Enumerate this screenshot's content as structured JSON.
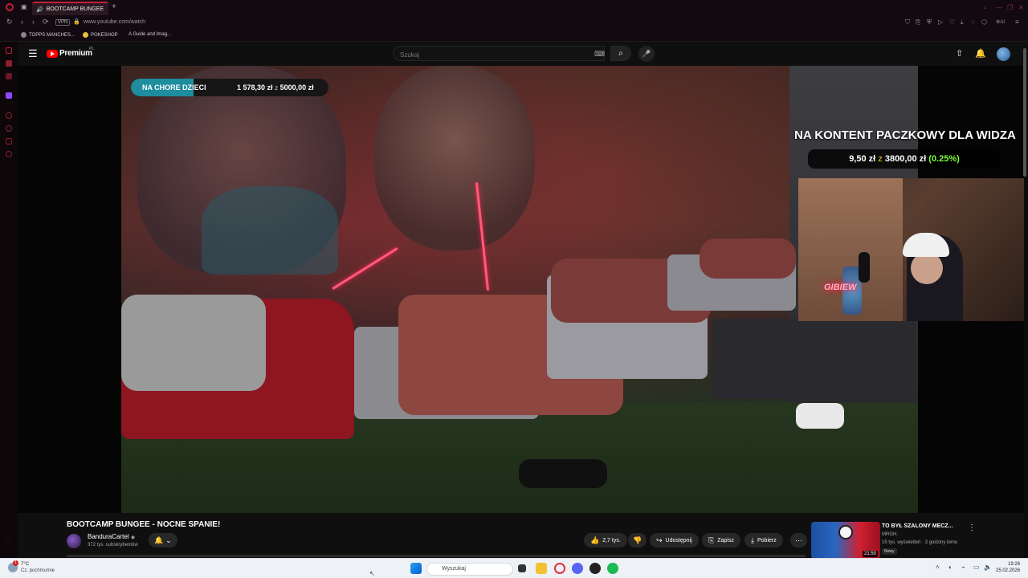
{
  "browser": {
    "tab_title": "BOOTCAMP BUNGEE",
    "vpn_label": "VPN",
    "url": "www.youtube.com/watch",
    "ai_label": "AI",
    "bookmarks": [
      {
        "label": "TOPPS MANCHES..."
      },
      {
        "label": "POKESHOP"
      },
      {
        "label": "A Guide and Imag..."
      }
    ]
  },
  "youtube": {
    "brand": "Premium",
    "brand_region": "PL",
    "search_placeholder": "Szukaj"
  },
  "overlay": {
    "donation_label": "NA CHORE DZIECI",
    "donation_current": "1 578,30 zł",
    "donation_sep": "z",
    "donation_goal": "5000,00 zł",
    "donation_progress": 0.3157,
    "goal_title": "NA KONTENT PACZKOWY DLA WIDZA",
    "goal_current": "9,50 zł",
    "goal_sep": "z",
    "goal_target": "3800,00 zł",
    "goal_percent": "(0.25%)",
    "webcam_neon": "GIBIEW"
  },
  "video": {
    "title": "BOOTCAMP BUNGEE - NOCNE SPANIE!",
    "channel": "BanduraCartel",
    "verified": "◉",
    "subscribers": "372 tys. subskrybentów",
    "likes": "2,7 tys.",
    "share": "Udostępnij",
    "save": "Zapisz",
    "download": "Pobierz"
  },
  "recommended": {
    "title": "TO BYŁ SZALONY MECZ...",
    "channel": "MRGH.",
    "meta": "15 tys. wyświetleń · 3 godziny temu",
    "badge": "Nowy",
    "duration": "21:50"
  },
  "taskbar": {
    "weather_temp": "7°C",
    "weather_desc": "Cz. pochmurnie",
    "weather_badge": "1",
    "search_placeholder": "Wyszukaj",
    "time": "19:26",
    "date": "25.02.2026"
  },
  "colors": {
    "accent": "#c41e3a",
    "youtube_red": "#ff0000",
    "donation_fill": "#1e8d9e",
    "goal_percent": "#7dff3a"
  }
}
